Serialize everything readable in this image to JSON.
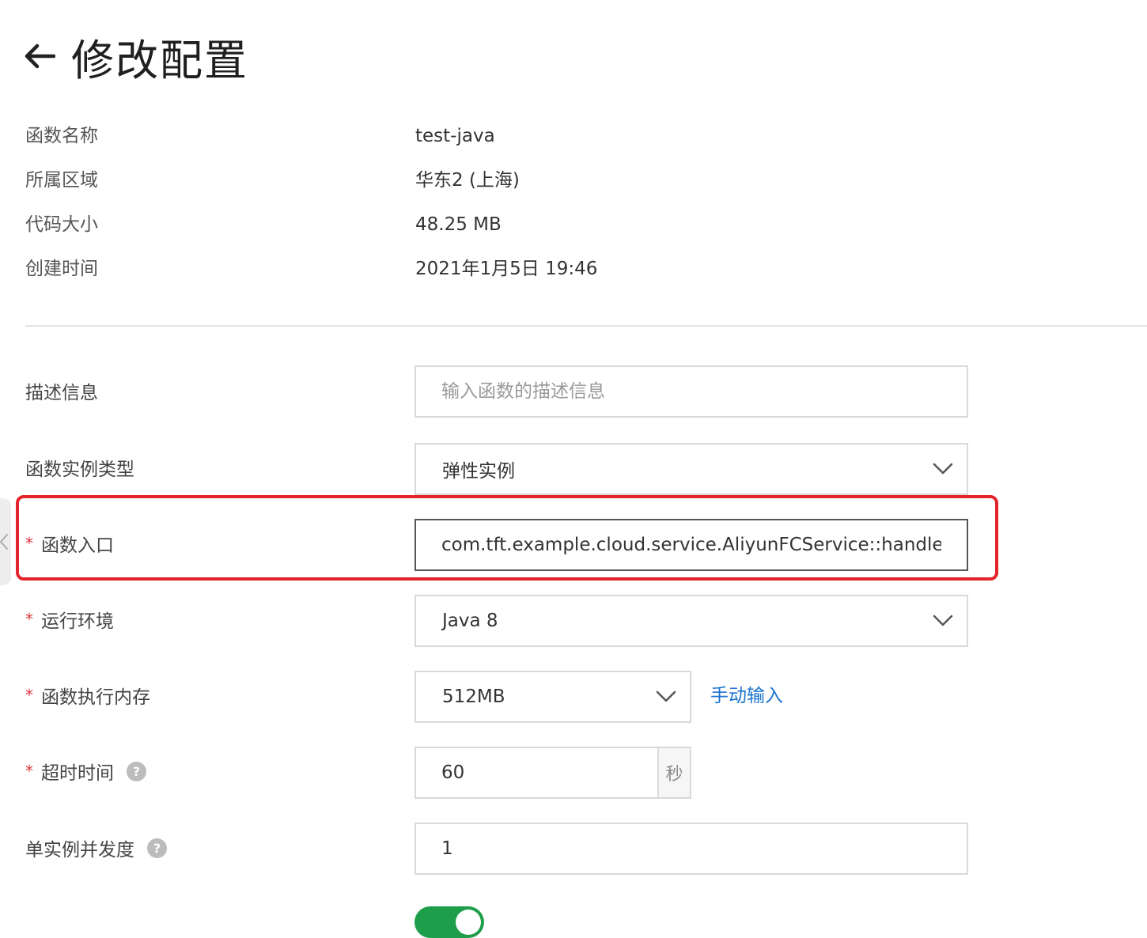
{
  "header": {
    "title": "修改配置"
  },
  "info": [
    {
      "label": "函数名称",
      "value": "test-java"
    },
    {
      "label": "所属区域",
      "value": "华东2 (上海)"
    },
    {
      "label": "代码大小",
      "value": "48.25 MB"
    },
    {
      "label": "创建时间",
      "value": "2021年1月5日 19:46"
    }
  ],
  "form": {
    "description": {
      "label": "描述信息",
      "placeholder": "输入函数的描述信息",
      "value": ""
    },
    "instance_type": {
      "label": "函数实例类型",
      "value": "弹性实例"
    },
    "handler": {
      "label": "函数入口",
      "value": "com.tft.example.cloud.service.AliyunFCService::handleF",
      "required_mark": "*"
    },
    "runtime": {
      "label": "运行环境",
      "value": "Java 8",
      "required_mark": "*"
    },
    "memory": {
      "label": "函数执行内存",
      "value": "512MB",
      "link": "手动输入",
      "required_mark": "*"
    },
    "timeout": {
      "label": "超时时间",
      "value": "60",
      "unit": "秒",
      "required_mark": "*",
      "help": "?"
    },
    "concurrency": {
      "label": "单实例并发度",
      "value": "1",
      "help": "?"
    }
  },
  "colors": {
    "required": "#d9363e",
    "link": "#1a73d0",
    "highlight": "#e3242b",
    "toggle_on": "#1e9e4a"
  },
  "toggle": {
    "on": true
  }
}
